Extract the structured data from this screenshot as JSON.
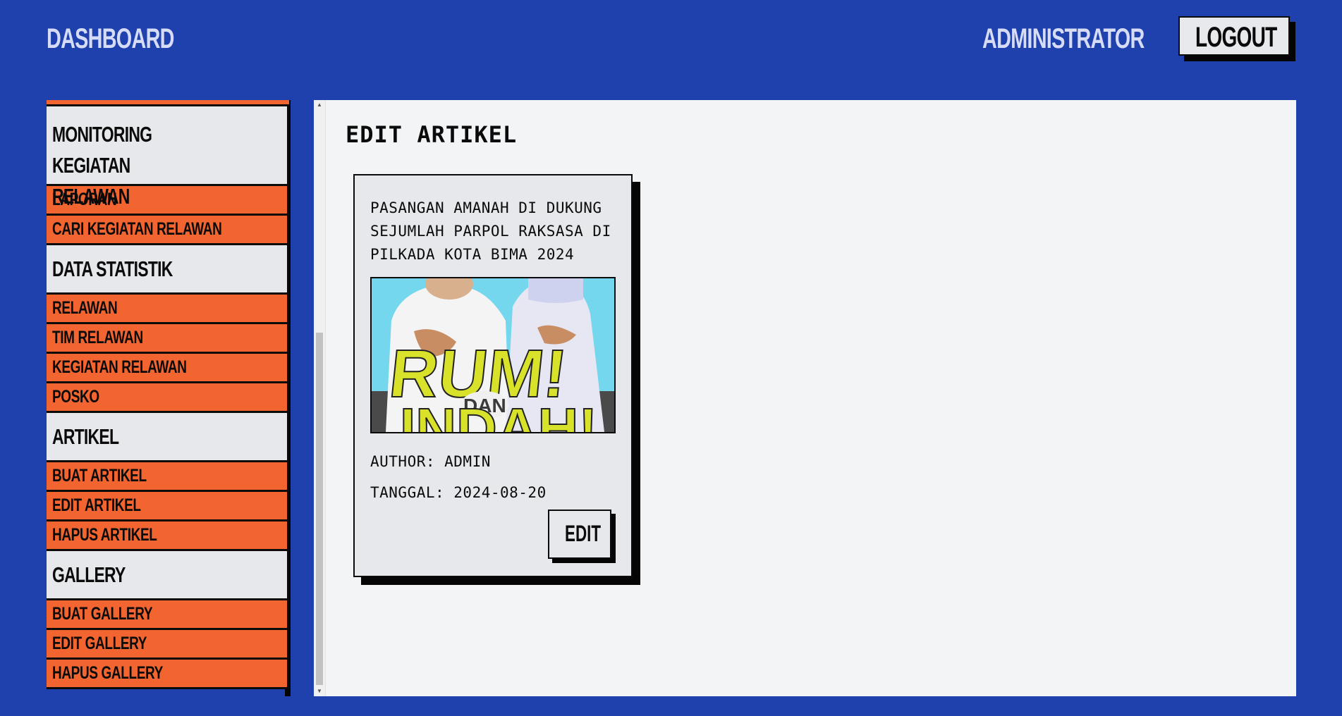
{
  "header": {
    "brand": "DASHBOARD",
    "user_label": "ADMINISTRATOR",
    "logout_label": "LOGOUT"
  },
  "sidebar": {
    "sections": [
      {
        "title": "MONITORING KEGIATAN RELAWAN",
        "title_line1": "MONITORING KEGIATAN",
        "title_line2": "RELAWAN",
        "items": [
          "LAPORAN",
          "CARI KEGIATAN RELAWAN"
        ]
      },
      {
        "title": "DATA STATISTIK",
        "items": [
          "RELAWAN",
          "TIM RELAWAN",
          "KEGIATAN RELAWAN",
          "POSKO"
        ]
      },
      {
        "title": "ARTIKEL",
        "items": [
          "BUAT ARTIKEL",
          "EDIT ARTIKEL",
          "HAPUS ARTIKEL"
        ]
      },
      {
        "title": "GALLERY",
        "items": [
          "BUAT GALLERY",
          "EDIT GALLERY",
          "HAPUS GALLERY"
        ]
      }
    ]
  },
  "main": {
    "page_title": "EDIT ARTIKEL",
    "articles": [
      {
        "title": "PASANGAN AMANAH DI DUKUNG SEJUMLAH PARPOL RAKSASA DI PILKADA KOTA BIMA 2024",
        "image_text_top": "RUM!",
        "image_text_mid": "DAN",
        "image_text_bottom": "INDAH!",
        "author": "AUTHOR: ADMIN",
        "date": "TANGGAL: 2024-08-20",
        "edit_label": "EDIT"
      }
    ]
  },
  "colors": {
    "background": "#1f41ae",
    "accent": "#f26530",
    "panel": "#e7e8ec",
    "text": "#0b0b0b"
  }
}
